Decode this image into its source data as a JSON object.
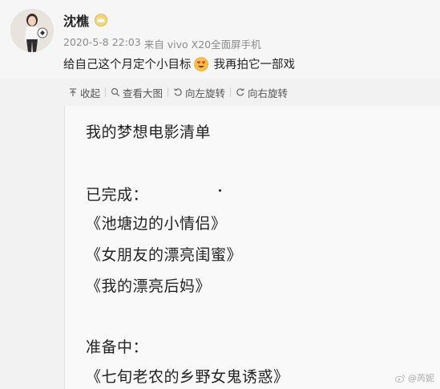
{
  "post": {
    "username": "沈樵",
    "date": "2020-5-8 22:03",
    "source_prefix": "来自",
    "source_device": "vivo X20全面屏手机",
    "text_before": "给自己这个月定个小目标",
    "text_after": "我再拍它一部戏",
    "badge_icon": "crown-icon",
    "emoji_icon": "heart-eyes-emoji-icon"
  },
  "toolbar": {
    "collapse": "收起",
    "view_large": "查看大图",
    "rotate_left": "向左旋转",
    "rotate_right": "向右旋转"
  },
  "image": {
    "title": "我的梦想电影清单",
    "done_heading": "已完成：",
    "done_items": [
      "《池塘边的小情侣》",
      "《女朋友的漂亮闺蜜》",
      "《我的漂亮后妈》"
    ],
    "todo_heading": "准备中：",
    "todo_items": [
      "《七旬老农的乡野女鬼诱惑》"
    ],
    "watermark": "@芮妮"
  },
  "colors": {
    "accent": "#f7b731",
    "meta_text": "#8a8a8a",
    "background": "#f2f2f2"
  }
}
